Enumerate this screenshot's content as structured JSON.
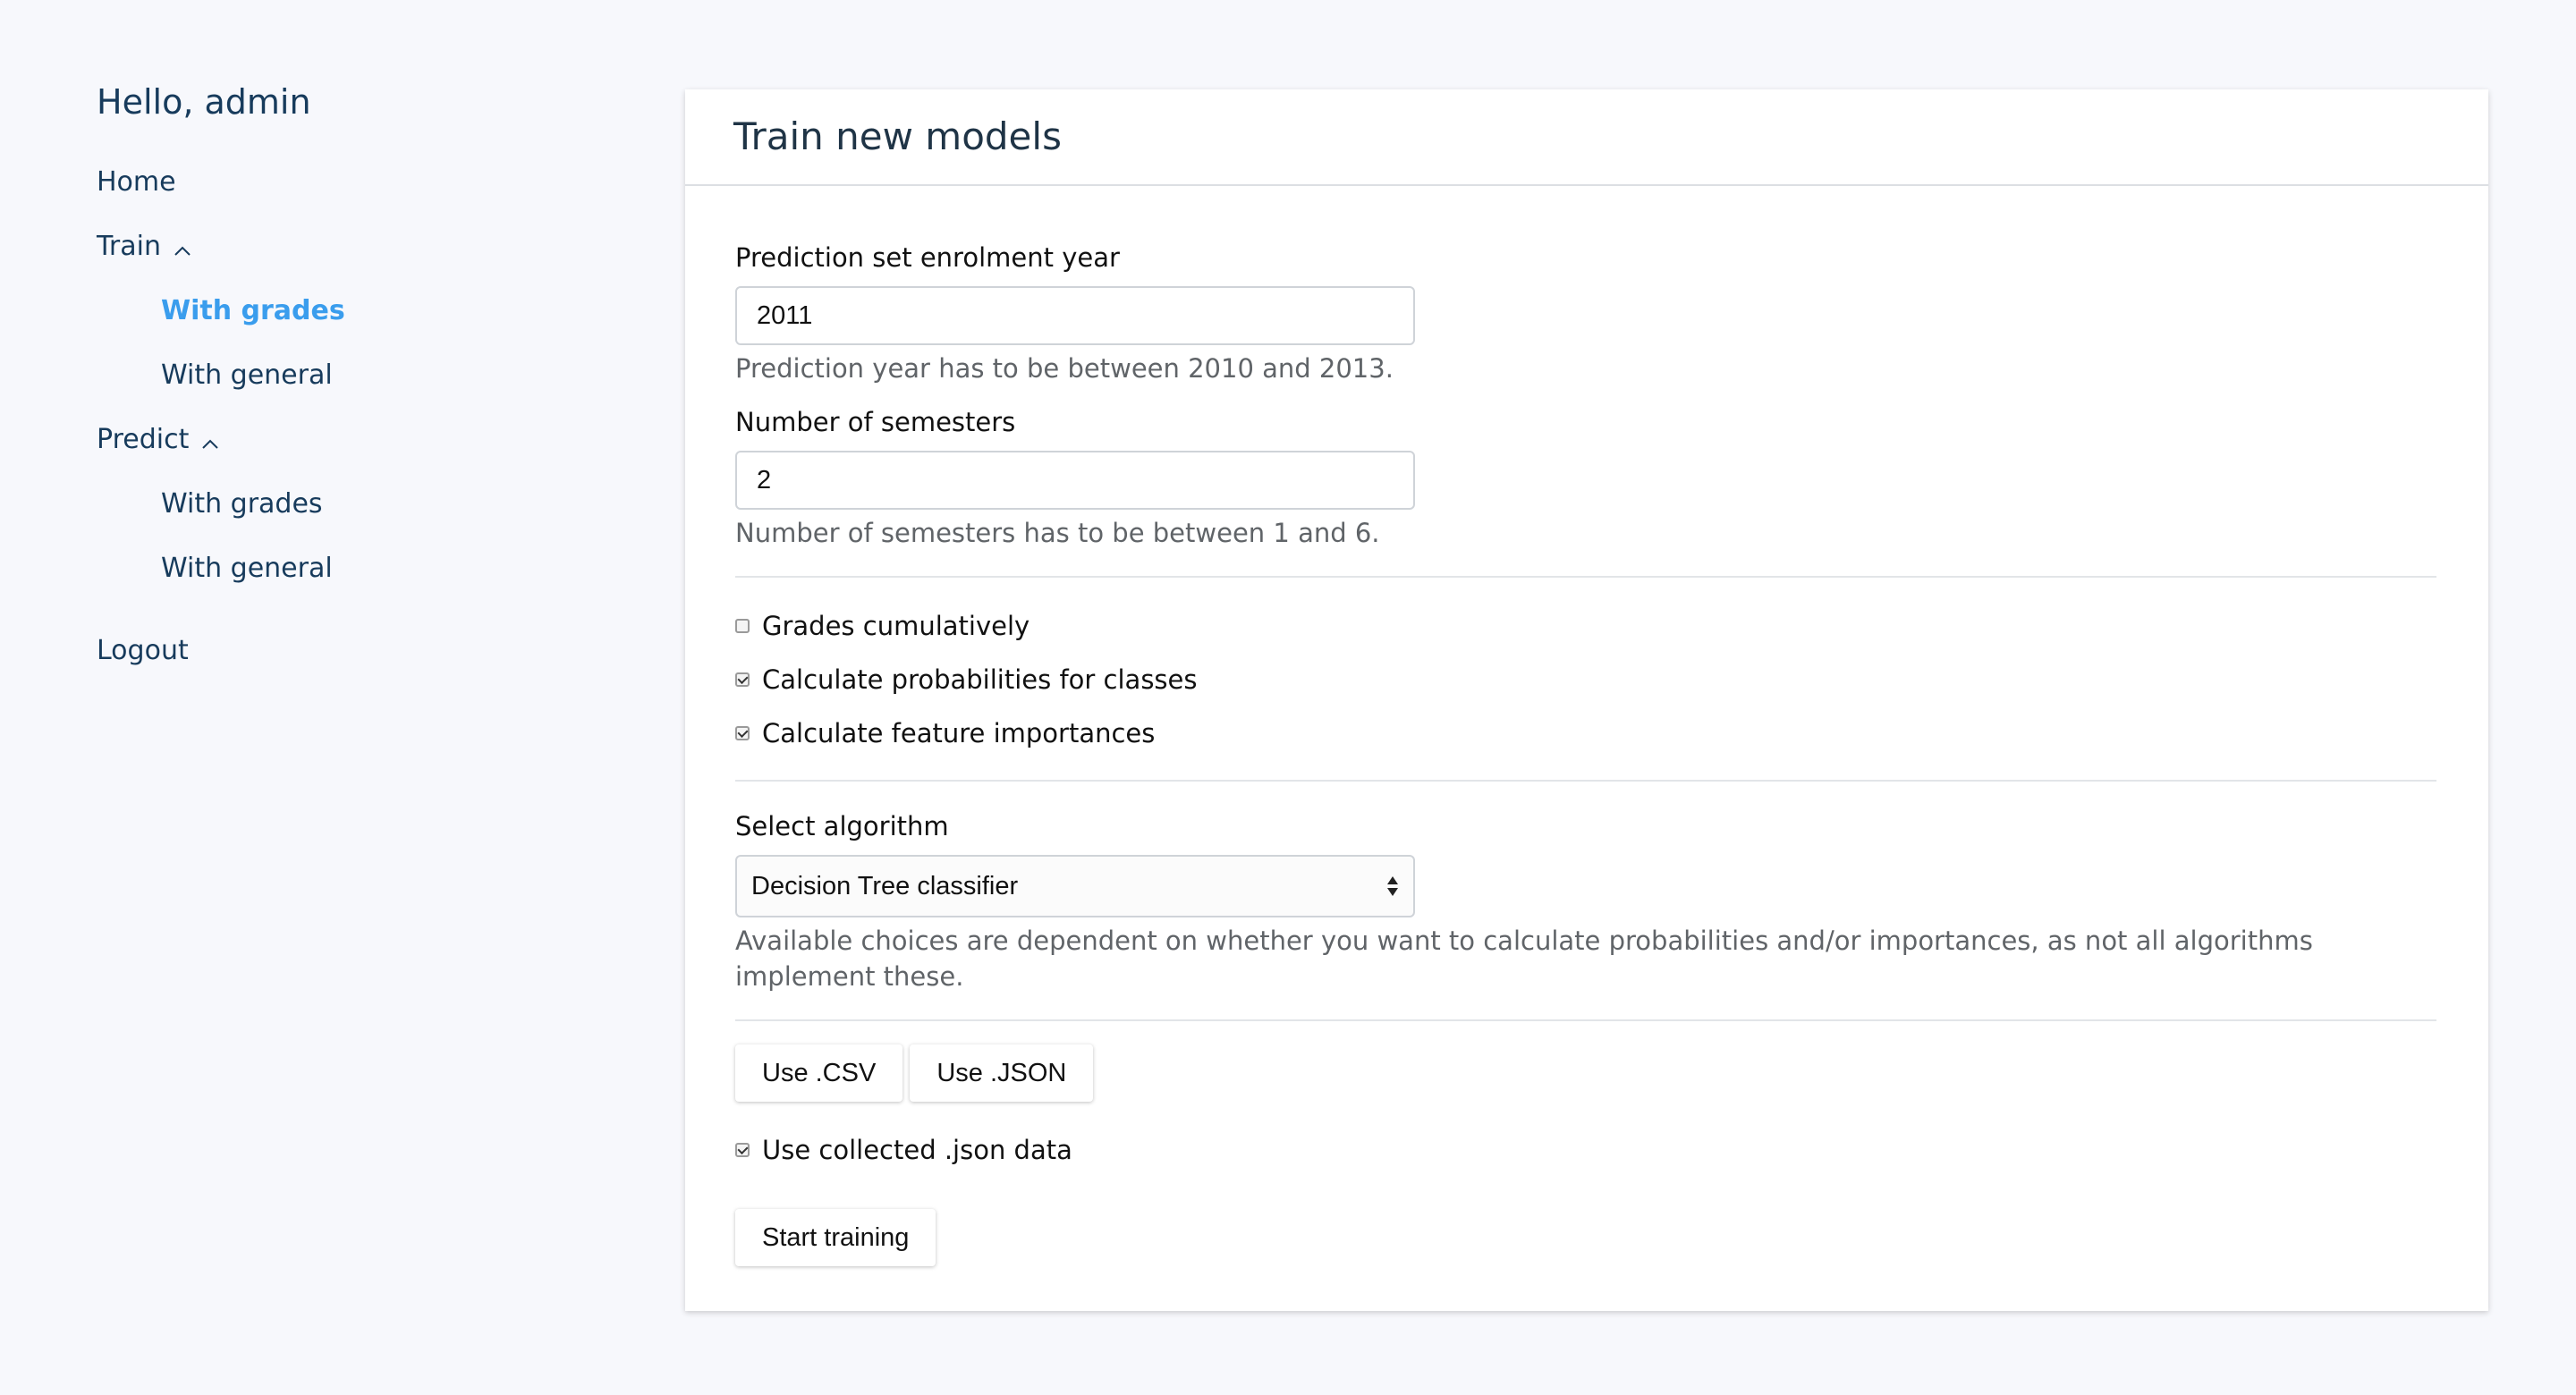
{
  "sidebar": {
    "greeting": "Hello, admin",
    "home": "Home",
    "train": {
      "label": "Train",
      "items": [
        "With grades",
        "With general"
      ]
    },
    "predict": {
      "label": "Predict",
      "items": [
        "With grades",
        "With general"
      ]
    },
    "logout": "Logout",
    "active_color": "#3a9ded"
  },
  "card": {
    "title": "Train new models",
    "year": {
      "label": "Prediction set enrolment year",
      "value": "2011",
      "help": "Prediction year has to be between 2010 and 2013."
    },
    "semesters": {
      "label": "Number of semesters",
      "value": "2",
      "help": "Number of semesters has to be between 1 and 6."
    },
    "checkboxes": [
      {
        "label": "Grades cumulatively",
        "checked": false
      },
      {
        "label": "Calculate probabilities for classes",
        "checked": true
      },
      {
        "label": "Calculate feature importances",
        "checked": true
      }
    ],
    "algorithm": {
      "label": "Select algorithm",
      "selected": "Decision Tree classifier",
      "help": "Available choices are dependent on whether you want to calculate probabilities and/or importances, as not all algorithms implement these."
    },
    "buttons": {
      "csv": "Use .CSV",
      "json": "Use .JSON"
    },
    "collected_json": {
      "label": "Use collected .json data",
      "checked": true
    },
    "start": "Start training"
  }
}
